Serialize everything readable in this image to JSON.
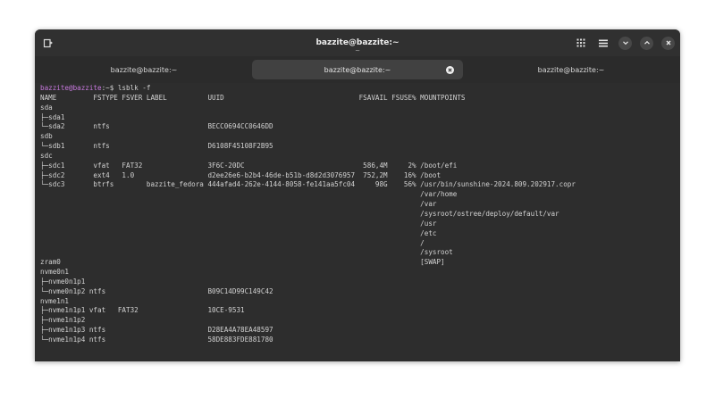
{
  "window": {
    "title": "bazzite@bazzite:~",
    "subtitle": "~"
  },
  "icons": {
    "new_tab": "new-tab-icon",
    "grid": "grid-icon",
    "menu": "hamburger-menu-icon",
    "minimize": "chevron-down-icon",
    "maximize": "chevron-up-icon",
    "close": "close-icon"
  },
  "tabs": [
    {
      "label": "bazzite@bazzite:~",
      "active": false
    },
    {
      "label": "bazzite@bazzite:~",
      "active": true
    },
    {
      "label": "bazzite@bazzite:~",
      "active": false
    }
  ],
  "terminal": {
    "prompt_user": "bazzite@bazzite",
    "prompt_rest": ":~$ lsblk -f",
    "lines": [
      "NAME         FSTYPE FSVER LABEL          UUID                                 FSAVAIL FSUSE% MOUNTPOINTS",
      "sda",
      "├─sda1",
      "└─sda2       ntfs                        BECC0694CC0646DD",
      "sdb",
      "└─sdb1       ntfs                        D6108F45108F2B95",
      "sdc",
      "├─sdc1       vfat   FAT32                3F6C-20DC                             586,4M     2% /boot/efi",
      "├─sdc2       ext4   1.0                  d2ee26e6-b2b4-46de-b51b-d8d2d3076957  752,2M    16% /boot",
      "└─sdc3       btrfs        bazzite_fedora 444afad4-262e-4144-8058-fe141aa5fc04     98G    56% /usr/bin/sunshine-2024.809.202917.copr",
      "                                                                                             /var/home",
      "                                                                                             /var",
      "                                                                                             /sysroot/ostree/deploy/default/var",
      "                                                                                             /usr",
      "                                                                                             /etc",
      "                                                                                             /",
      "                                                                                             /sysroot",
      "zram0                                                                                        [SWAP]",
      "nvme0n1",
      "├─nvme0n1p1",
      "└─nvme0n1p2 ntfs                         B09C14D99C149C42",
      "nvme1n1",
      "├─nvme1n1p1 vfat   FAT32                 10CE-9531",
      "├─nvme1n1p2",
      "├─nvme1n1p3 ntfs                         D28EA4A78EA48597",
      "└─nvme1n1p4 ntfs                         58DE883FDE881780"
    ]
  },
  "colors": {
    "prompt_user": "#c678dd",
    "terminal_bg": "#2d2d2d",
    "text": "#d2d2d2"
  }
}
